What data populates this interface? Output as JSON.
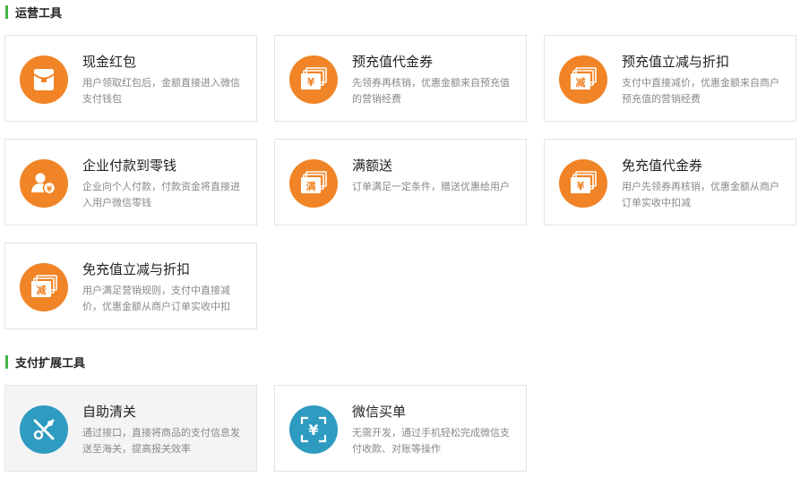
{
  "sections": [
    {
      "title": "运营工具"
    },
    {
      "title": "支付扩展工具"
    }
  ],
  "cards": [
    {
      "title": "现金红包",
      "desc": "用户领取红包后，金额直接进入微信支付钱包",
      "icon": "red-packet-icon"
    },
    {
      "title": "预充值代金券",
      "desc": "先领券再核销，优惠金额来自预充值的营销经费",
      "icon": "yuan-voucher-icon",
      "glyph": "¥"
    },
    {
      "title": "预充值立减与折扣",
      "desc": "支付中直接减价，优惠金额来自商户预充值的营销经费",
      "icon": "discount-voucher-icon",
      "glyph": "减"
    },
    {
      "title": "企业付款到零钱",
      "desc": "企业向个人付款，付款资金将直接进入用户微信零钱",
      "icon": "enterprise-payment-icon"
    },
    {
      "title": "满额送",
      "desc": "订单满足一定条件，赠送优惠给用户",
      "icon": "full-amount-gift-icon",
      "glyph": "满"
    },
    {
      "title": "免充值代金券",
      "desc": "用户先领券再核销，优惠金额从商户订单实收中扣减",
      "icon": "yuan-voucher-icon",
      "glyph": "¥"
    },
    {
      "title": "免充值立减与折扣",
      "desc": "用户满足营销规则，支付中直接减价，优惠金额从商户订单实收中扣",
      "icon": "discount-voucher-icon",
      "glyph": "减"
    },
    {
      "title": "自助清关",
      "desc": "通过接口，直接将商品的支付信息发送至海关，提高报关效率",
      "icon": "customs-tools-icon"
    },
    {
      "title": "微信买单",
      "desc": "无需开发，通过手机轻松完成微信支付收款、对账等操作",
      "icon": "scan-yuan-icon",
      "glyph": "¥"
    }
  ],
  "colors": {
    "accent_green": "#44b549",
    "icon_orange": "#f08426",
    "icon_teal": "#2e9bc1"
  }
}
